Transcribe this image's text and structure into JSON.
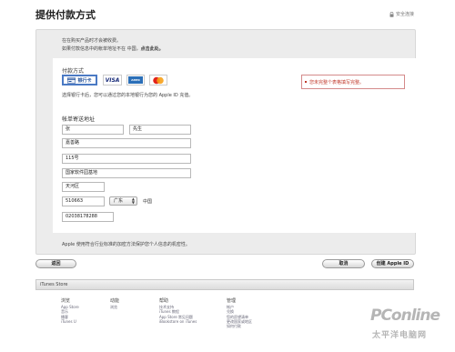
{
  "header": {
    "title": "提供付款方式",
    "secure_label": "安全连接"
  },
  "intro": {
    "line1": "在在购买产品时才会被收费。",
    "line2_prefix": "如果付款信息中的帐单地址不在 中国，",
    "line2_link": "点击此处。"
  },
  "payment": {
    "section_label": "付款方式",
    "options": [
      {
        "label": "银行卡",
        "icon": "bank-card-icon",
        "selected": true
      },
      {
        "label": "VISA",
        "icon": "visa-icon"
      },
      {
        "label": "AMEX",
        "icon": "amex-icon"
      },
      {
        "label": "MasterCard",
        "icon": "mastercard-icon"
      }
    ],
    "bank_hint": "选择银行卡后，您可以通过您的本地银行为您的 Apple ID 充值。",
    "error_text": "您未完整个表格填写完整。"
  },
  "address": {
    "section_label": "帐单寄送地址",
    "last_name": "张",
    "first_name": "先生",
    "street1": "嘉善路",
    "street2": "115号",
    "street3": "国家软件园基地",
    "city": "天河区",
    "postal_code": "510663",
    "province": "广东",
    "country": "中国",
    "phone": "02038178288"
  },
  "secure_note": "Apple 使用符合行业标准的加密方法保护您个人信息的机密性。",
  "buttons": {
    "back": "返回",
    "cancel": "取消",
    "create": "创建 Apple ID"
  },
  "store_bar": {
    "label": "iTunes Store"
  },
  "footer": {
    "columns": [
      {
        "title": "浏览",
        "links": [
          "App Store",
          "音乐",
          "播客",
          "iTunes U"
        ]
      },
      {
        "title": "动能",
        "links": [
          "浏览"
        ]
      },
      {
        "title": "帮助",
        "links": [
          "技术支持",
          "iTunes 教程",
          "App Store 常见问题",
          "iBookstore on iTunes"
        ]
      },
      {
        "title": "管理",
        "links": [
          "帐户",
          "兑换",
          "您的愿望清单",
          "更改国家或地区",
          "如何付款"
        ]
      }
    ]
  },
  "watermark": {
    "brand": "PConline",
    "sub": "太平洋电脑网"
  }
}
